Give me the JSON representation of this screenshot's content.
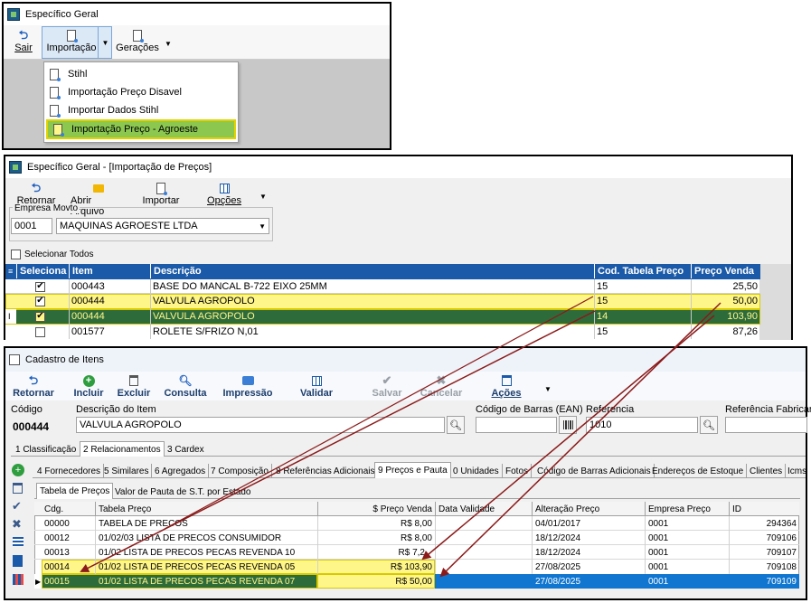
{
  "win1": {
    "title": "Específico Geral",
    "toolbar": {
      "sair": "Sair",
      "importacao": "Importação",
      "geracoes": "Gerações"
    },
    "menu": [
      "Stihl",
      "Importação Preço Disavel",
      "Importar Dados Stihl",
      "Importação Preço - Agroeste"
    ],
    "selected_menu_index": 3
  },
  "win2": {
    "title": "Específico Geral - [Importação de Preços]",
    "toolbar": {
      "retornar": "Retornar",
      "abrir": "Abrir Arquivo",
      "importar": "Importar",
      "opcoes": "Opções"
    },
    "empresa_label": "Empresa Movto",
    "empresa_code": "0001",
    "empresa_name": "MAQUINAS AGROESTE LTDA",
    "select_all": "Selecionar Todos",
    "columns": [
      "Seleciona",
      "Item",
      "Descrição",
      "Cod. Tabela Preço",
      "Preço Venda"
    ],
    "rows": [
      {
        "checked": "✔",
        "item": "000443",
        "desc": "BASE DO MANCAL B-722 EIXO 25MM",
        "cod": "15",
        "preco": "25,50"
      },
      {
        "checked": "✔",
        "item": "000444",
        "desc": "VALVULA AGROPOLO",
        "cod": "15",
        "preco": "50,00"
      },
      {
        "checked": "✔",
        "item": "000444",
        "desc": "VALVULA AGROPOLO",
        "cod": "14",
        "preco": "103,90"
      },
      {
        "checked": "",
        "item": "001577",
        "desc": "ROLETE S/FRIZO N,01",
        "cod": "15",
        "preco": "87,26"
      }
    ]
  },
  "win3": {
    "title": "Cadastro de Itens",
    "toolbar": {
      "retornar": "Retornar",
      "incluir": "Incluir",
      "excluir": "Excluir",
      "consulta": "Consulta",
      "impressao": "Impressão",
      "validar": "Validar",
      "salvar": "Salvar",
      "cancelar": "Cancelar",
      "acoes": "Ações"
    },
    "labels": {
      "codigo": "Código",
      "descricao": "Descrição do Item",
      "ean": "Código de Barras (EAN)",
      "referencia": "Referencia",
      "ref_fab": "Referência Fabrican"
    },
    "codigo": "000444",
    "descricao": "VALVULA AGROPOLO",
    "referencia": "1010",
    "tabs1": [
      "1 Classificação",
      "2 Relacionamentos",
      "3 Cardex"
    ],
    "tabs2": [
      "4 Fornecedores",
      "5 Similares",
      "6 Agregados",
      "7 Composição",
      "8 Referências Adicionais",
      "9 Preços e Pauta",
      "0 Unidades",
      "Fotos",
      "Código de Barras Adicionais",
      "Endereços de Estoque",
      "Clientes",
      "Icms"
    ],
    "tabs3": [
      "Tabela de Preços",
      "Valor de Pauta de S.T. por Estado"
    ],
    "columns": [
      "Cdg.",
      "Tabela Preço",
      "$ Preço Venda",
      "Data Validade",
      "Alteração Preço",
      "Empresa Preço",
      "ID"
    ],
    "rows": [
      {
        "cdg": "00000",
        "tabela": "TABELA DE PRECOS",
        "preco": "R$ 8,00",
        "validade": "",
        "alteracao": "04/01/2017",
        "empresa": "0001",
        "id": "294364"
      },
      {
        "cdg": "00012",
        "tabela": "01/02/03 LISTA DE PRECOS CONSUMIDOR",
        "preco": "R$ 8,00",
        "validade": "",
        "alteracao": "18/12/2024",
        "empresa": "0001",
        "id": "709106"
      },
      {
        "cdg": "00013",
        "tabela": "01/02 LISTA DE PRECOS PECAS REVENDA 10",
        "preco": "R$ 7,2",
        "validade": "",
        "alteracao": "18/12/2024",
        "empresa": "0001",
        "id": "709107"
      },
      {
        "cdg": "00014",
        "tabela": "01/02 LISTA DE PRECOS PECAS REVENDA 05",
        "preco": "R$ 103,90",
        "validade": "",
        "alteracao": "27/08/2025",
        "empresa": "0001",
        "id": "709108"
      },
      {
        "cdg": "00015",
        "tabela": "01/02 LISTA DE PRECOS PECAS REVENDA 07",
        "preco": "R$ 50,00",
        "validade": "",
        "alteracao": "27/08/2025",
        "empresa": "0001",
        "id": "709109"
      }
    ]
  },
  "colors": {
    "highlight_yellow": "#fff68a",
    "highlight_green": "#2e6b3a",
    "menu_green": "#8cc850",
    "header_blue": "#1b5aa8",
    "selected_blue": "#1076d0",
    "arrow_red": "#8b1a1a"
  }
}
